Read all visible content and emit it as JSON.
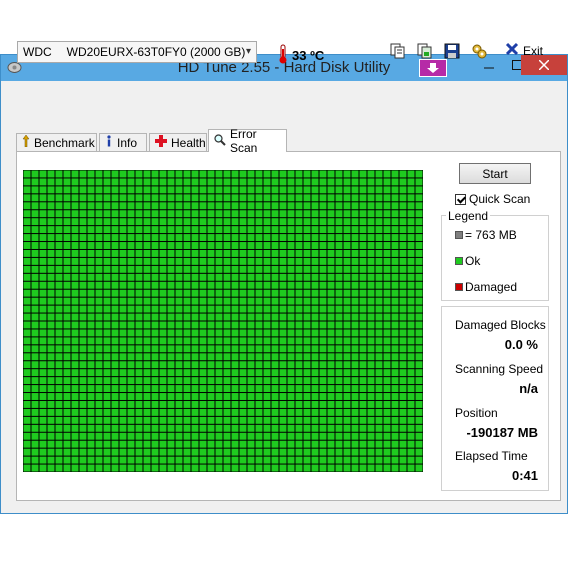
{
  "window": {
    "title": "HD Tune 2.55 - Hard Disk Utility"
  },
  "toolbar": {
    "drive_brand": "WDC",
    "drive_model": "WD20EURX-63T0FY0 (2000 GB)",
    "temperature": "33 ºC",
    "exit_label": "Exit"
  },
  "tabs": [
    {
      "label": "Benchmark",
      "icon": "benchmark-icon"
    },
    {
      "label": "Info",
      "icon": "info-icon"
    },
    {
      "label": "Health",
      "icon": "health-icon"
    },
    {
      "label": "Error Scan",
      "icon": "magnifier-icon",
      "active": true
    }
  ],
  "scan": {
    "start_label": "Start",
    "quick_scan_label": "Quick Scan",
    "quick_scan_checked": true,
    "grid_cols": 50,
    "grid_rows": 38,
    "ok_color": "#1fcb1f",
    "gridline_color": "#000000"
  },
  "legend": {
    "title": "Legend",
    "items": [
      {
        "label": "= 763 MB",
        "color": "#808080"
      },
      {
        "label": "Ok",
        "color": "#1fcb1f"
      },
      {
        "label": "Damaged",
        "color": "#cc0000"
      }
    ]
  },
  "stats": {
    "damaged_blocks_label": "Damaged Blocks",
    "damaged_blocks_value": "0.0 %",
    "scanning_speed_label": "Scanning Speed",
    "scanning_speed_value": "n/a",
    "position_label": "Position",
    "position_value": "-190187 MB",
    "elapsed_label": "Elapsed Time",
    "elapsed_value": "0:41"
  }
}
